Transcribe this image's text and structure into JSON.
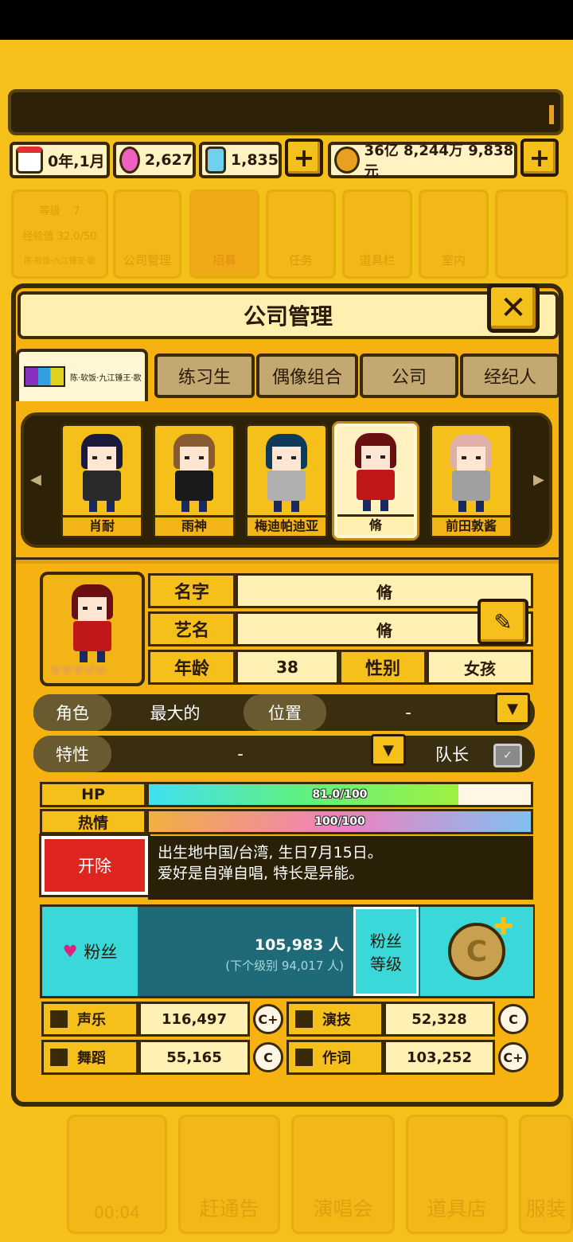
{
  "resources": {
    "date": "0年,1月",
    "gems": "2,627",
    "crystals": "1,835",
    "money": "36亿 8,244万 9,838元"
  },
  "bg_menu": {
    "level_label": "等级",
    "level_value": "7",
    "exp": "经验值 32.0/50",
    "company_name": "陈·软饭·九江锤王·歌",
    "items": [
      "公司管理",
      "招募",
      "任务",
      "道具栏",
      "室内"
    ]
  },
  "panel": {
    "title": "公司管理",
    "tabs": [
      "陈·软饭·九江锤王·歌",
      "练习生",
      "偶像组合",
      "公司",
      "经纪人"
    ]
  },
  "roster": [
    {
      "name": "肖耐",
      "hair": "#1a1a3a",
      "shirt": "#2a2a2a"
    },
    {
      "name": "雨神",
      "hair": "#8a5a30",
      "shirt": "#1a1a1a"
    },
    {
      "name": "梅迪帕迪亚",
      "hair": "#103a5a",
      "shirt": "#b0b0b0"
    },
    {
      "name": "脩",
      "hair": "#6a1010",
      "shirt": "#c01818"
    },
    {
      "name": "前田敦酱",
      "hair": "#e0b0a8",
      "shirt": "#a0a0a0"
    }
  ],
  "profile": {
    "name_label": "名字",
    "name": "脩",
    "stage_label": "艺名",
    "stage_name": "脩",
    "age_label": "年龄",
    "age": "38",
    "gender_label": "性别",
    "gender": "女孩",
    "role_label": "角色",
    "role": "最大的",
    "position_label": "位置",
    "position": "-",
    "trait_label": "特性",
    "trait": "-",
    "leader_label": "队长"
  },
  "bars": {
    "hp_label": "HP",
    "hp_text": "81.0/100",
    "hp_value": 0.81,
    "passion_label": "热情",
    "passion_text": "100/100",
    "passion_value": 1.0
  },
  "dismiss_label": "开除",
  "bio": {
    "line1": "出生地中国/台湾, 生日7月15日。",
    "line2": "爱好是自弹自唱, 特长是异能。"
  },
  "fans": {
    "label": "粉丝",
    "count": "105,983 人",
    "next": "(下个级别 94,017 人)",
    "level_label_1": "粉丝",
    "level_label_2": "等级"
  },
  "stats": [
    {
      "name": "声乐",
      "value": "116,497",
      "grade": "C+"
    },
    {
      "name": "演技",
      "value": "52,328",
      "grade": "C"
    },
    {
      "name": "舞蹈",
      "value": "55,165",
      "grade": "C"
    },
    {
      "name": "作词",
      "value": "103,252",
      "grade": "C+"
    }
  ],
  "bottom_nav": {
    "timer": "00:04",
    "items": [
      "赶通告",
      "演唱会",
      "道具店",
      "服装"
    ]
  }
}
